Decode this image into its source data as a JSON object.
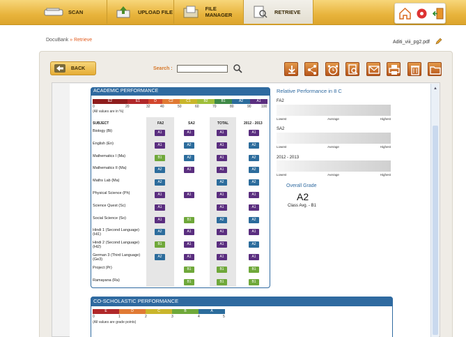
{
  "nav": {
    "scan": "SCAN",
    "upload": "UPLOAD FILE",
    "file_manager": "FILE MANAGER",
    "retrieve": "RETRIEVE"
  },
  "breadcrumb": {
    "root": "DocuBank",
    "separator": "»",
    "current": "Retrieve"
  },
  "file_name": "Aditi_viii_pg2.pdf",
  "back_label": "BACK",
  "search": {
    "label": "Search :",
    "value": ""
  },
  "academic": {
    "title": "ACADEMIC PERFORMANCE",
    "scale_grades": [
      "E2",
      "E1",
      "D",
      "C2",
      "C1",
      "B2",
      "B1",
      "A2",
      "A1"
    ],
    "scale_ticks": [
      "0",
      "20",
      "32",
      "40",
      "50",
      "60",
      "70",
      "80",
      "90",
      "100"
    ],
    "note": "(All values are in %)",
    "headers": {
      "subject": "SUBJECT",
      "fa2": "FA2",
      "sa2": "SA2",
      "total": "TOTAL",
      "prev": "2012 - 2013"
    },
    "rows": [
      {
        "subject": "Biology (Bi)",
        "fa2": "A1",
        "sa2": "A1",
        "total": "A1",
        "prev": "A1"
      },
      {
        "subject": "English (En)",
        "fa2": "A1",
        "sa2": "A2",
        "total": "A1",
        "prev": "A2"
      },
      {
        "subject": "Mathematics I (Ma)",
        "fa2": "B1",
        "sa2": "A2",
        "total": "A1",
        "prev": "A2"
      },
      {
        "subject": "Mathematics II (Ma)",
        "fa2": "A2",
        "sa2": "A1",
        "total": "A1",
        "prev": "A2"
      },
      {
        "subject": "Maths Lab (Ma)",
        "fa2": "A2",
        "sa2": "",
        "total": "A2",
        "prev": "A2"
      },
      {
        "subject": "Physical Science (Ph)",
        "fa2": "A1",
        "sa2": "A1",
        "total": "A1",
        "prev": "A1"
      },
      {
        "subject": "Science Quest (Sc)",
        "fa2": "A1",
        "sa2": "",
        "total": "A1",
        "prev": "A1"
      },
      {
        "subject": "Social Science (So)",
        "fa2": "A1",
        "sa2": "B1",
        "total": "A2",
        "prev": "A2"
      },
      {
        "subject": "Hindi 1 (Second Language) (Hi1)",
        "fa2": "A2",
        "sa2": "A1",
        "total": "A1",
        "prev": "A1"
      },
      {
        "subject": "Hindi 2 (Second Language) (Hi2)",
        "fa2": "B1",
        "sa2": "A1",
        "total": "A1",
        "prev": "A2"
      },
      {
        "subject": "German 3 (Third Language) (Ge3)",
        "fa2": "A2",
        "sa2": "A1",
        "total": "A1",
        "prev": "A1"
      },
      {
        "subject": "Project (Pr)",
        "fa2": "",
        "sa2": "B1",
        "total": "B1",
        "prev": "B1"
      },
      {
        "subject": "Ramayana (Ra)",
        "fa2": "",
        "sa2": "B1",
        "total": "B1",
        "prev": "B1"
      }
    ]
  },
  "relative": {
    "title": "Relative Performance in 8 C",
    "strips": [
      {
        "label": "FA2"
      },
      {
        "label": "SA2"
      },
      {
        "label": "2012 - 2013"
      }
    ],
    "axis": {
      "low": "Lowest",
      "avg": "Average",
      "high": "Highest"
    },
    "overall_label": "Overall Grade",
    "overall_value": "A2",
    "class_avg": "Class Avg. - B1"
  },
  "coscholastic": {
    "title": "CO-SCHOLASTIC PERFORMANCE",
    "grades": [
      "E",
      "D",
      "C",
      "B",
      "A"
    ],
    "ticks": [
      "0",
      "1",
      "2",
      "3",
      "4",
      "5"
    ],
    "note": "(All values are grade points)"
  },
  "colors": {
    "accent": "#e8b43c",
    "blue": "#2f6aa0",
    "A1": "#5a2e7f",
    "A2": "#2c6c9c",
    "B1": "#6fa83a"
  }
}
